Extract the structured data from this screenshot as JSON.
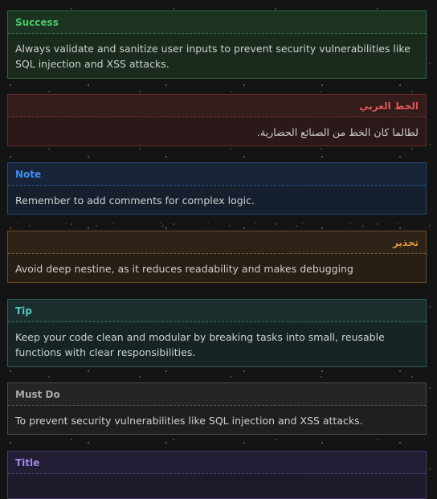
{
  "callouts": [
    {
      "type": "success",
      "title": "Success",
      "body": "Always validate and sanitize user inputs to prevent security vulnerabilities like SQL injection and XSS attacks.",
      "color": "#4cc86a",
      "dir": "ltr"
    },
    {
      "type": "danger",
      "title": "الخط العربي",
      "body": "لطالما كان الخط من الصنائع الحضارية.",
      "color": "#e05757",
      "dir": "rtl"
    },
    {
      "type": "note",
      "title": "Note",
      "body": "Remember to add comments for complex logic.",
      "color": "#3f8ef0",
      "dir": "ltr"
    },
    {
      "type": "warning",
      "title": "تحذير",
      "body": "Avoid deep nestine, as it reduces readability and makes debugging",
      "color": "#e09538",
      "dir": "rtl-header"
    },
    {
      "type": "tip",
      "title": "Tip",
      "body": "Keep your code clean and modular by breaking tasks into small, reusable functions with clear responsibilities.",
      "color": "#4ecdc4",
      "dir": "ltr"
    },
    {
      "type": "must-do",
      "title": "Must Do",
      "body": "To prevent security vulnerabilities like SQL injection and XSS attacks.",
      "color": "#a8a8a8",
      "dir": "ltr"
    },
    {
      "type": "title",
      "title": "Title",
      "body": "",
      "color": "#a387ec",
      "dir": "ltr"
    }
  ]
}
